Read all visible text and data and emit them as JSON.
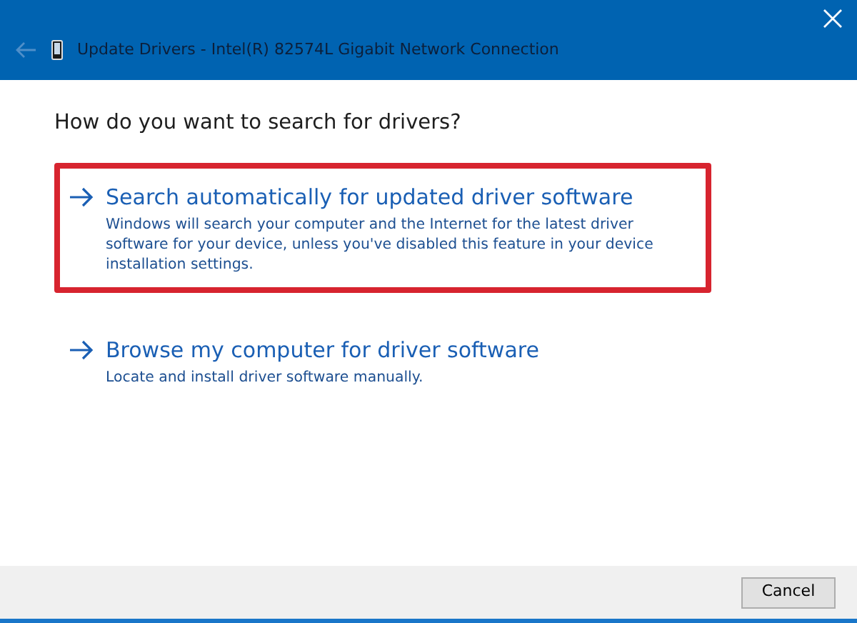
{
  "window": {
    "title": "Update Drivers - Intel(R) 82574L Gigabit Network Connection",
    "back_disabled": true
  },
  "heading": "How do you want to search for drivers?",
  "options": [
    {
      "title": "Search automatically for updated driver software",
      "description": "Windows will search your computer and the Internet for the latest driver software for your device, unless you've disabled this feature in your device installation settings.",
      "highlighted": true
    },
    {
      "title": "Browse my computer for driver software",
      "description": "Locate and install driver software manually.",
      "highlighted": false
    }
  ],
  "buttons": [
    "Cancel"
  ]
}
